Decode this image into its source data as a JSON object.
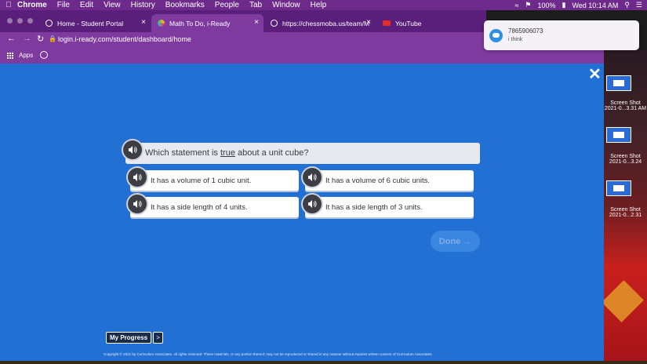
{
  "menubar": {
    "app": "Chrome",
    "items": [
      "File",
      "Edit",
      "View",
      "History",
      "Bookmarks",
      "People",
      "Tab",
      "Window",
      "Help"
    ],
    "battery": "100%",
    "datetime": "Wed 10:14 AM"
  },
  "tabs": [
    {
      "title": "Home - Student Portal",
      "icon": "globe-icon"
    },
    {
      "title": "Math To Do, i-Ready",
      "icon": "iready-icon"
    },
    {
      "title": "https://chessmoba.us/team/M",
      "icon": "globe-icon"
    },
    {
      "title": "YouTube",
      "icon": "youtube-icon"
    }
  ],
  "address": {
    "url": "login.i-ready.com/student/dashboard/home"
  },
  "bookmarks": {
    "apps_label": "Apps"
  },
  "question": {
    "prefix": "Which statement is ",
    "emphasis": "true",
    "suffix": " about a unit cube?"
  },
  "choices": [
    {
      "text": "It has a volume of 1 cubic unit."
    },
    {
      "text": "It has a volume of 6 cubic units."
    },
    {
      "text": "It has a side length of 4 units."
    },
    {
      "text": "It has a side length of 3 units."
    }
  ],
  "done_label": "Done →",
  "progress": {
    "label": "My Progress",
    "arrow": ">"
  },
  "copyright": "Copyright © 2021 by Curriculum Associates. All rights reserved. These materials, or any portion thereof, may not be reproduced or shared in any manner without express written consent of Curriculum Associates.",
  "notification": {
    "title": "7865906073",
    "body": "i think"
  },
  "desktop": {
    "items": [
      "Screen Shot 2021-0...3.31 AM",
      "Screen Shot 2021-0...3.24",
      "Screen Shot 2021-0...2.31"
    ]
  }
}
